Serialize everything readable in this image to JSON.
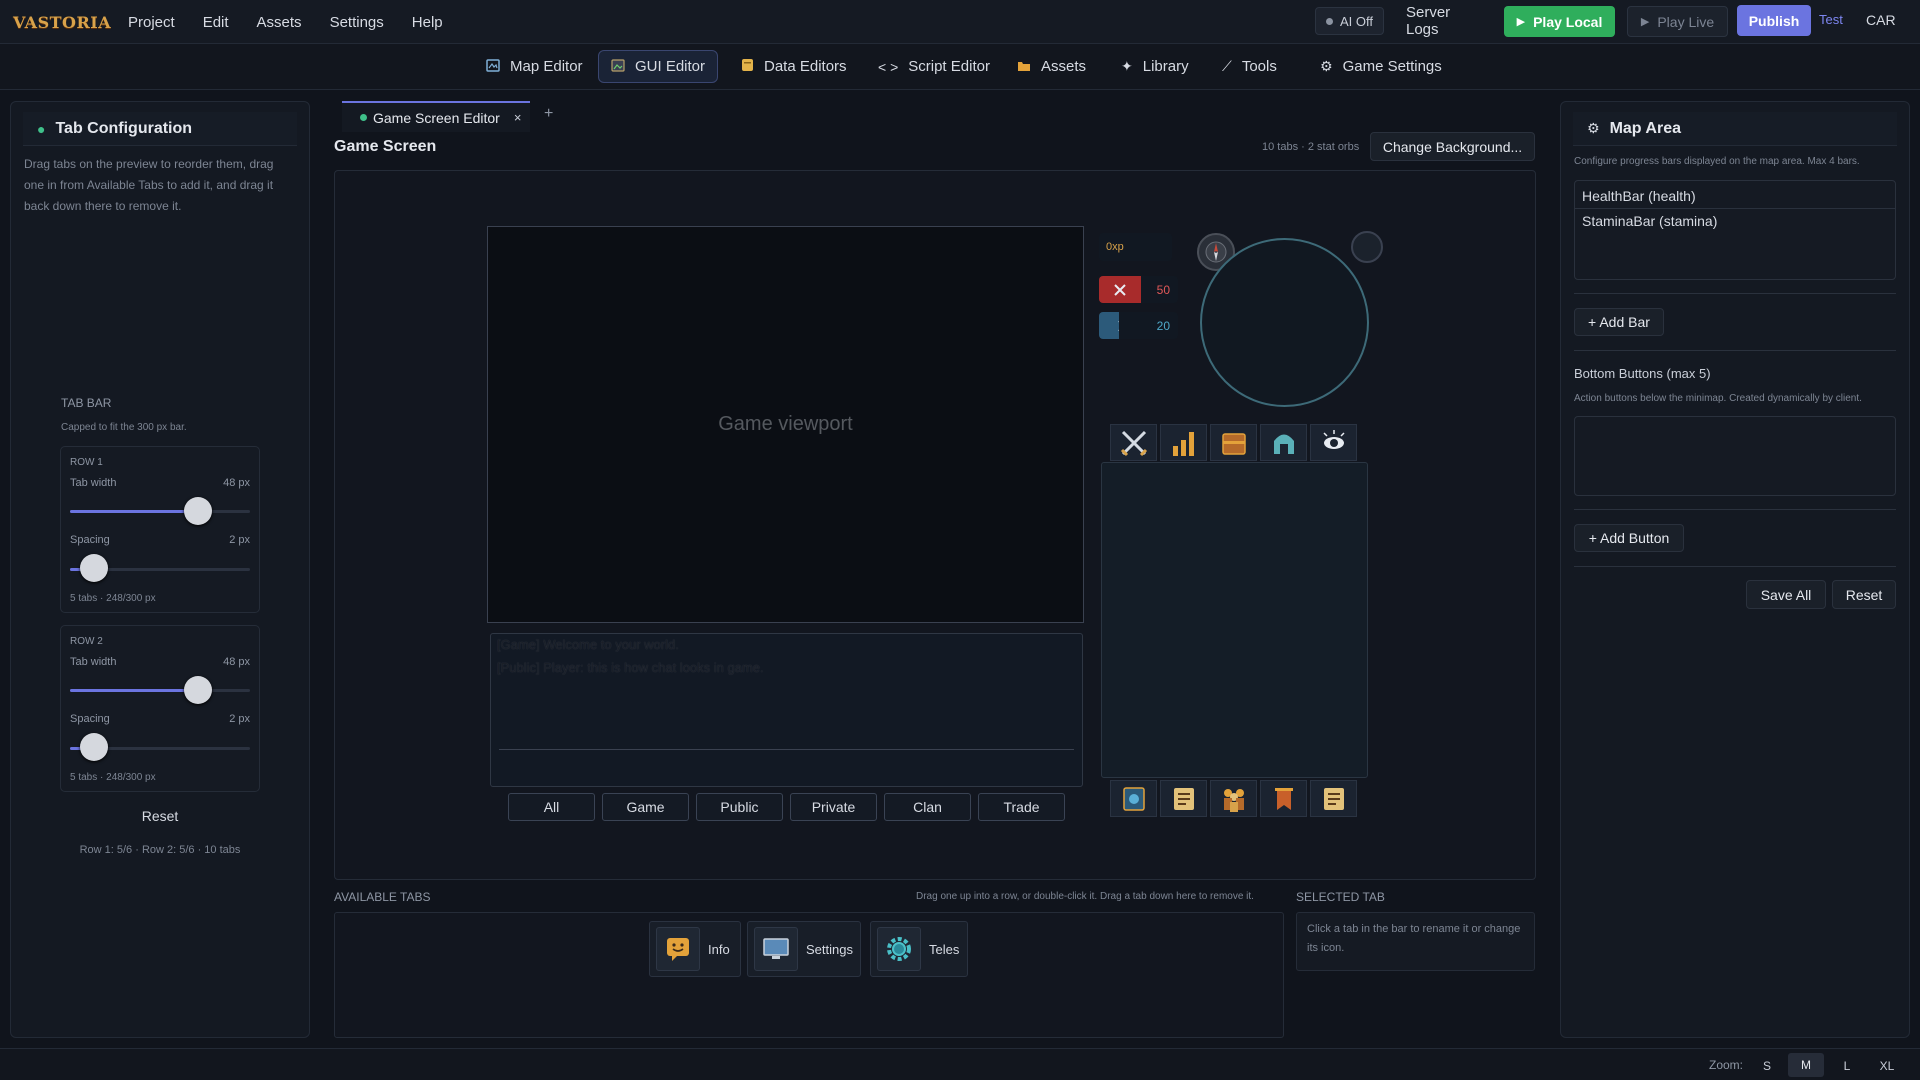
{
  "app": {
    "logo_text": "VASTORIA"
  },
  "menu": [
    "Project",
    "Edit",
    "Assets",
    "Settings",
    "Help"
  ],
  "topbar": {
    "ai_label": "AI Off",
    "server_logs": "Server Logs",
    "play_local": "Play Local",
    "play_live": "Play Live",
    "publish": "Publish",
    "test": "Test",
    "user": "CAR"
  },
  "tabs": [
    {
      "label": "Map Editor",
      "icon": "map-icon"
    },
    {
      "label": "GUI Editor",
      "icon": "image-icon",
      "active": true
    },
    {
      "label": "Data Editors",
      "icon": "database-icon"
    },
    {
      "label": "Script Editor",
      "icon": "code-icon",
      "glyph": "< >"
    },
    {
      "label": "Assets",
      "icon": "folder-icon"
    },
    {
      "label": "Library",
      "icon": "sparkle-icon",
      "glyph": "✦"
    },
    {
      "label": "Tools",
      "icon": "wrench-icon",
      "glyph": "⟋"
    },
    {
      "label": "Game Settings",
      "icon": "gear-icon",
      "glyph": "⚙"
    }
  ],
  "left": {
    "title": "Tab Configuration",
    "description": "Drag tabs on the preview to reorder them, drag one in from Available Tabs to add it, and drag it back down there to remove it.",
    "tab_bar_heading": "TAB BAR",
    "tab_bar_note": "Capped to fit the 300 px bar.",
    "rows": [
      {
        "label": "ROW 1",
        "width_label": "Tab width",
        "width_value": "48 px",
        "width_fraction": 0.71,
        "spacing_label": "Spacing",
        "spacing_value": "2 px",
        "spacing_fraction": 0.13,
        "summary": "5 tabs · 248/300 px"
      },
      {
        "label": "ROW 2",
        "width_label": "Tab width",
        "width_value": "48 px",
        "width_fraction": 0.71,
        "spacing_label": "Spacing",
        "spacing_value": "2 px",
        "spacing_fraction": 0.13,
        "summary": "5 tabs · 248/300 px"
      }
    ],
    "reset": "Reset",
    "footer": "Row 1: 5/6 · Row 2: 5/6 · 10 tabs"
  },
  "center": {
    "doc_tab": "Game Screen Editor",
    "doc_tab_close": "×",
    "add_tab": "+",
    "title": "Game Screen",
    "stats": "10 tabs · 2 stat orbs",
    "change_bg": "Change Background...",
    "viewport_label": "Game viewport",
    "chat_lines": [
      "[Game] Welcome to your world.",
      "[Public] Player: this is how chat looks in game."
    ],
    "chat_tabs": [
      "All",
      "Game",
      "Public",
      "Private",
      "Clan",
      "Trade"
    ],
    "xp": "0xp",
    "orbs": [
      {
        "value": "50",
        "color": "#a82b2b",
        "icon": "swords-icon"
      },
      {
        "value": "20",
        "color": "#2c5a7a",
        "icon": "swords-icon"
      }
    ],
    "top_tab_icons": [
      "swords-icon",
      "stats-icon",
      "chest-icon",
      "helmet-icon",
      "eye-icon"
    ],
    "bottom_tab_icons": [
      "spellbook-icon",
      "quest-icon",
      "people-icon",
      "banner-icon",
      "quest-list-icon"
    ],
    "available_heading": "AVAILABLE TABS",
    "available_hint": "Drag one up into a row, or double-click it. Drag a tab down here to remove it.",
    "available_tabs": [
      {
        "label": "Info",
        "icon": "smile-icon"
      },
      {
        "label": "Settings",
        "icon": "monitor-icon"
      },
      {
        "label": "Teles",
        "icon": "gear-icon"
      }
    ],
    "selected_heading": "SELECTED TAB",
    "selected_hint": "Click a tab in the bar to rename it or change its icon."
  },
  "right": {
    "title": "Map Area",
    "description": "Configure progress bars displayed on the map area. Max 4 bars.",
    "bars": [
      "HealthBar (health)",
      "StaminaBar (stamina)"
    ],
    "add_bar": "+ Add Bar",
    "bottom_heading": "Bottom Buttons (max 5)",
    "bottom_desc": "Action buttons below the minimap. Created dynamically by client.",
    "add_button": "+ Add Button",
    "save_all": "Save All",
    "reset": "Reset"
  },
  "zoom": {
    "label": "Zoom:",
    "options": [
      "S",
      "M",
      "L",
      "XL"
    ],
    "selected": "M"
  },
  "colors": {
    "accent": "#6b74e0",
    "play_green": "#2fae5c",
    "bg": "#10141c"
  }
}
